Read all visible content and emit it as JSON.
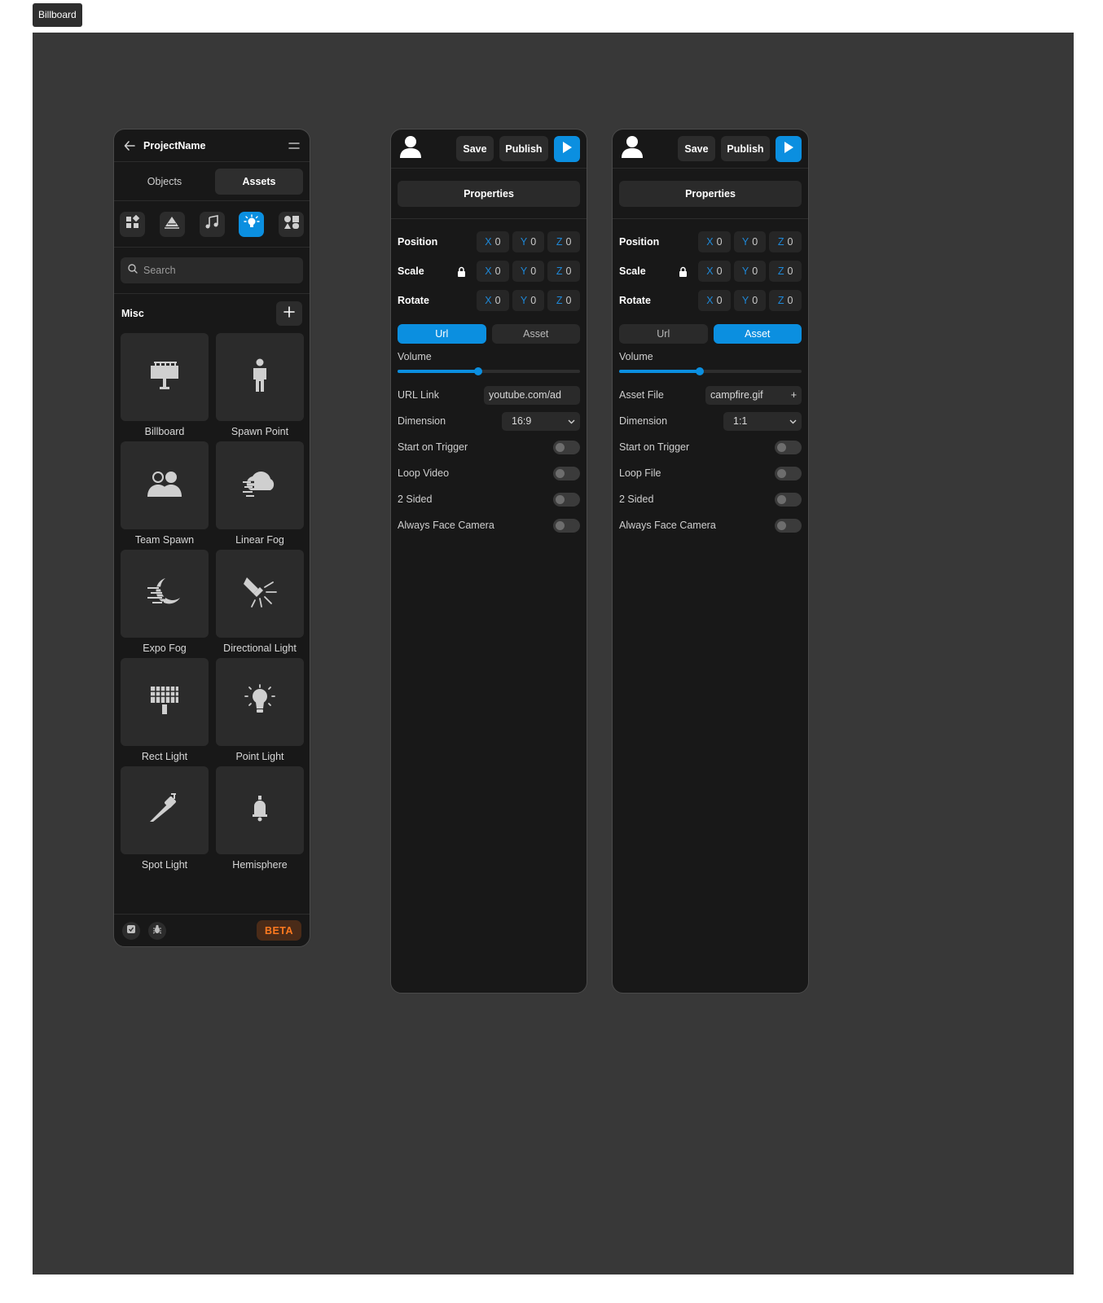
{
  "frame_label": "Billboard",
  "left": {
    "project_name": "ProjectName",
    "tabs": [
      {
        "label": "Objects",
        "active": false
      },
      {
        "label": "Assets",
        "active": true
      }
    ],
    "categories": [
      "shapes-icon",
      "terrain-icon",
      "music-icon",
      "light-bulb-icon",
      "primitives-icon"
    ],
    "active_category": "light-bulb-icon",
    "search_placeholder": "Search",
    "section_label": "Misc",
    "items": [
      {
        "label": "Billboard",
        "icon": "billboard-icon"
      },
      {
        "label": "Spawn Point",
        "icon": "person-icon"
      },
      {
        "label": "Team Spawn",
        "icon": "team-icon"
      },
      {
        "label": "Linear Fog",
        "icon": "cloud-fog-icon"
      },
      {
        "label": "Expo Fog",
        "icon": "moon-fog-icon"
      },
      {
        "label": "Directional Light",
        "icon": "flashlight-icon"
      },
      {
        "label": "Rect Light",
        "icon": "rect-light-icon"
      },
      {
        "label": "Point Light",
        "icon": "bulb-icon"
      },
      {
        "label": "Spot Light",
        "icon": "spot-light-icon"
      },
      {
        "label": "Hemisphere",
        "icon": "hemisphere-light-icon"
      }
    ],
    "badge": "BETA",
    "accent": "#0b8fe0"
  },
  "panels": [
    {
      "save": "Save",
      "publish": "Publish",
      "title": "Properties",
      "transforms": [
        {
          "label": "Position",
          "lock": false,
          "x": "0",
          "y": "0",
          "z": "0"
        },
        {
          "label": "Scale",
          "lock": true,
          "x": "0",
          "y": "0",
          "z": "0"
        },
        {
          "label": "Rotate",
          "lock": false,
          "x": "0",
          "y": "0",
          "z": "0"
        }
      ],
      "axes": [
        "X",
        "Y",
        "Z"
      ],
      "source_tabs": [
        "Url",
        "Asset"
      ],
      "active_source": "Url",
      "volume_label": "Volume",
      "volume": 0.44,
      "source_field_label": "URL Link",
      "source_field_value": "youtube.com/ad",
      "dimension_label": "Dimension",
      "dimension_value": "16:9",
      "toggles": [
        "Start on Trigger",
        "Loop Video",
        "2 Sided",
        "Always Face Camera"
      ]
    },
    {
      "save": "Save",
      "publish": "Publish",
      "title": "Properties",
      "transforms": [
        {
          "label": "Position",
          "lock": false,
          "x": "0",
          "y": "0",
          "z": "0"
        },
        {
          "label": "Scale",
          "lock": true,
          "x": "0",
          "y": "0",
          "z": "0"
        },
        {
          "label": "Rotate",
          "lock": false,
          "x": "0",
          "y": "0",
          "z": "0"
        }
      ],
      "axes": [
        "X",
        "Y",
        "Z"
      ],
      "source_tabs": [
        "Url",
        "Asset"
      ],
      "active_source": "Asset",
      "volume_label": "Volume",
      "volume": 0.44,
      "source_field_label": "Asset File",
      "source_field_value": "campfire.gif",
      "source_field_action": "+",
      "dimension_label": "Dimension",
      "dimension_value": "1:1",
      "toggles": [
        "Start on Trigger",
        "Loop File",
        "2 Sided",
        "Always Face Camera"
      ]
    }
  ]
}
